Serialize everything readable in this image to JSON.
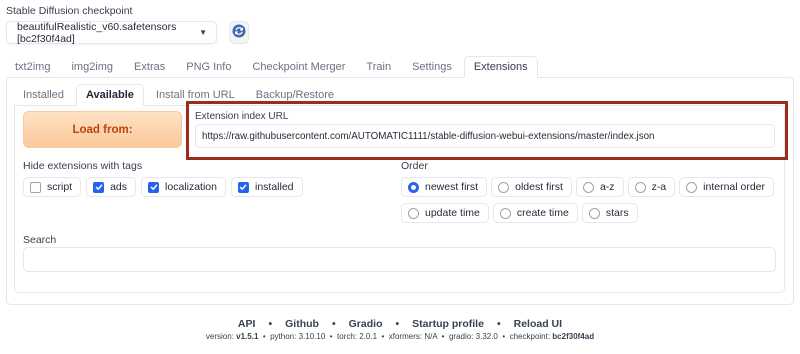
{
  "checkpoint": {
    "label": "Stable Diffusion checkpoint",
    "value": "beautifulRealistic_v60.safetensors [bc2f30f4ad]"
  },
  "top_tabs": [
    "txt2img",
    "img2img",
    "Extras",
    "PNG Info",
    "Checkpoint Merger",
    "Train",
    "Settings",
    "Extensions"
  ],
  "top_tab_active": "Extensions",
  "sub_tabs": [
    "Installed",
    "Available",
    "Install from URL",
    "Backup/Restore"
  ],
  "sub_tab_active": "Available",
  "load_button": "Load from:",
  "extension_index": {
    "label": "Extension index URL",
    "value": "https://raw.githubusercontent.com/AUTOMATIC1111/stable-diffusion-webui-extensions/master/index.json"
  },
  "hide_tags": {
    "label": "Hide extensions with tags",
    "options": [
      {
        "label": "script",
        "checked": false
      },
      {
        "label": "ads",
        "checked": true
      },
      {
        "label": "localization",
        "checked": true
      },
      {
        "label": "installed",
        "checked": true
      }
    ]
  },
  "order": {
    "label": "Order",
    "options": [
      "newest first",
      "oldest first",
      "a-z",
      "z-a",
      "internal order",
      "update time",
      "create time",
      "stars"
    ],
    "selected": "newest first"
  },
  "search": {
    "label": "Search",
    "value": ""
  },
  "footer": {
    "links": [
      "API",
      "Github",
      "Gradio",
      "Startup profile",
      "Reload UI"
    ],
    "separator": "•",
    "version_label": "version:",
    "version": "v1.5.1",
    "python_label": "python:",
    "python": "3.10.10",
    "torch_label": "torch:",
    "torch": "2.0.1",
    "xformers_label": "xformers:",
    "xformers": "N/A",
    "gradio_label": "gradio:",
    "gradio": "3.32.0",
    "checkpoint_label": "checkpoint:",
    "checkpoint": "bc2f30f4ad"
  },
  "colors": {
    "accent": "#2563eb",
    "load_button_text": "#c2410c",
    "highlight_border": "#9b2c1e"
  },
  "icons": [
    "chevron-down-icon",
    "refresh-icon",
    "checkmark-icon"
  ]
}
